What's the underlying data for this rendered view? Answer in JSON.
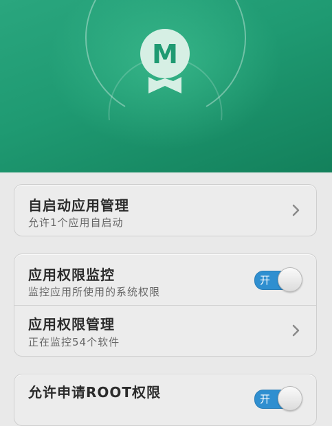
{
  "colors": {
    "hero_top": "#2aa67e",
    "hero_bottom": "#13805b",
    "toggle_on": "#2f8fd0",
    "background": "#e9e9e9"
  },
  "hero": {
    "logo_letter": "M",
    "icon": "badge-m-icon"
  },
  "sections": [
    {
      "rows": [
        {
          "title": "自启动应用管理",
          "subtitle": "允许1个应用自启动",
          "control": "chevron-right-icon"
        }
      ]
    },
    {
      "rows": [
        {
          "title": "应用权限监控",
          "subtitle": "监控应用所使用的系统权限",
          "control": "toggle",
          "toggle_label": "开",
          "toggle_state": "on"
        },
        {
          "title": "应用权限管理",
          "subtitle": "正在监控54个软件",
          "control": "chevron-right-icon"
        }
      ]
    },
    {
      "rows": [
        {
          "title": "允许申请ROOT权限",
          "control": "toggle",
          "toggle_label": "开",
          "toggle_state": "on"
        }
      ]
    }
  ]
}
